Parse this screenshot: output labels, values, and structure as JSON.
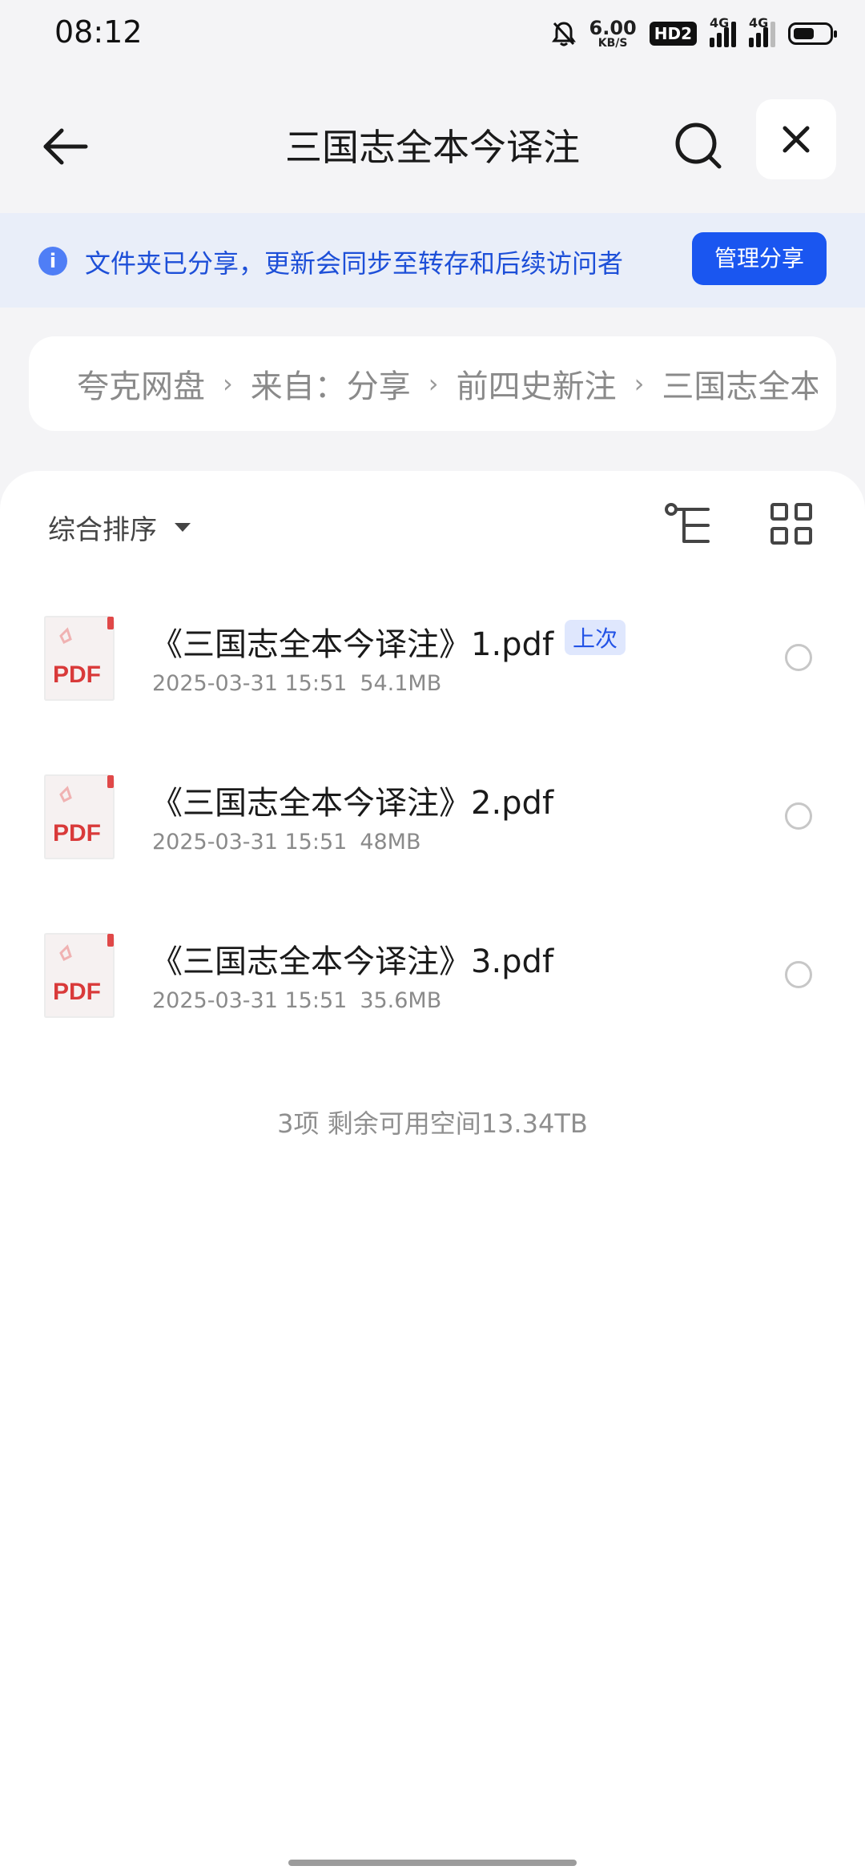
{
  "status_bar": {
    "time": "08:12",
    "net_speed_value": "6.00",
    "net_speed_unit": "KB/S",
    "hd_label": "HD2",
    "sim1_label": "4G",
    "sim2_label": "4G",
    "battery_level": 0.6,
    "icons": [
      "bell-off-icon",
      "hd-icon",
      "signal-icon",
      "battery-icon"
    ]
  },
  "header": {
    "title": "三国志全本今译注",
    "back_icon": "arrow-left-icon",
    "search_icon": "search-icon",
    "close_icon": "close-icon"
  },
  "notice": {
    "text": "文件夹已分享，更新会同步至转存和后续访问者",
    "button_label": "管理分享",
    "accent": "#1a56f0"
  },
  "breadcrumb": {
    "items": [
      "夸克网盘",
      "来自：分享",
      "前四史新注",
      "三国志全本今译注"
    ]
  },
  "toolbar": {
    "sort_label": "综合排序",
    "tree_icon": "tree-view-icon",
    "grid_icon": "grid-view-icon"
  },
  "files": [
    {
      "name": "《三国志全本今译注》1.pdf",
      "tag": "上次",
      "date": "2025-03-31 15:51",
      "size": "54.1MB",
      "icon_label": "PDF"
    },
    {
      "name": "《三国志全本今译注》2.pdf",
      "tag": "",
      "date": "2025-03-31 15:51",
      "size": "48MB",
      "icon_label": "PDF"
    },
    {
      "name": "《三国志全本今译注》3.pdf",
      "tag": "",
      "date": "2025-03-31 15:51",
      "size": "35.6MB",
      "icon_label": "PDF"
    }
  ],
  "summary": "3项 剩余可用空间13.34TB"
}
